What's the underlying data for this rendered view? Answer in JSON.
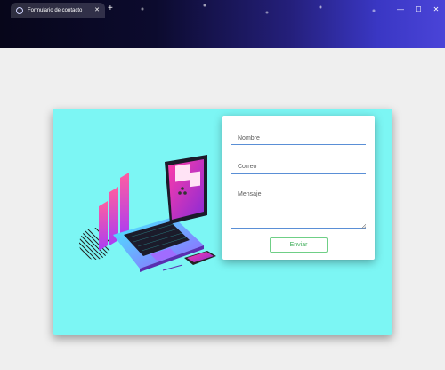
{
  "browser": {
    "tab_title": "Formulario de contacto",
    "tab_close": "✕",
    "new_tab": "+",
    "controls": {
      "minimize": "—",
      "maximize": "☐",
      "close": "✕"
    }
  },
  "form": {
    "name_placeholder": "Nombre",
    "email_placeholder": "Correo",
    "message_placeholder": "Mensaje",
    "submit_label": "Enviar"
  },
  "colors": {
    "card_background": "#7cf6f4",
    "input_underline": "#5a8fd6",
    "button_border": "#6fcf86",
    "button_text": "#3fae5a"
  }
}
